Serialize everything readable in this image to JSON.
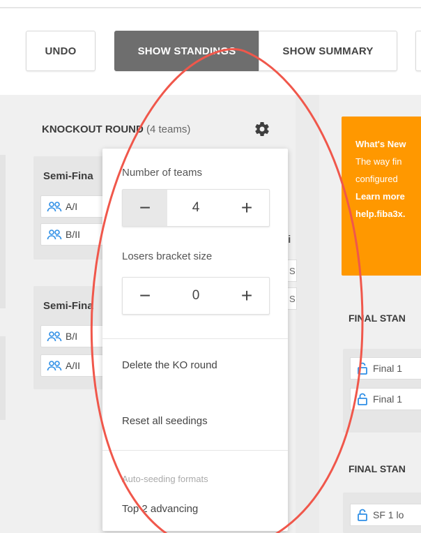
{
  "toolbar": {
    "undo_label": "UNDO",
    "show_standings_label": "SHOW STANDINGS",
    "show_summary_label": "SHOW SUMMARY"
  },
  "knockout": {
    "title": "KNOCKOUT ROUND",
    "team_count": "(4 teams)",
    "semis": [
      {
        "title": "Semi-Fina",
        "teams": [
          "A/I",
          "B/II"
        ]
      },
      {
        "title": "Semi-Fina",
        "teams": [
          "B/I",
          "A/II"
        ]
      }
    ],
    "fragments": {
      "gi": "gi",
      "s1": "S",
      "s2": "S"
    }
  },
  "popover": {
    "teams_label": "Number of teams",
    "teams_value": "4",
    "losers_label": "Losers bracket size",
    "losers_value": "0",
    "minus": "−",
    "plus": "+",
    "delete_label": "Delete the KO round",
    "reset_label": "Reset all seedings",
    "auto_seeding_label": "Auto-seeding formats",
    "top2_label": "Top 2 advancing"
  },
  "whats_new": {
    "title": "What's New",
    "line1": "The way fin",
    "line2": "configured",
    "link1": "Learn more",
    "link2": "help.fiba3x."
  },
  "final_standings": [
    {
      "title": "FINAL STAN",
      "items": [
        "Final 1",
        "Final 1"
      ]
    },
    {
      "title": "FINAL STAN",
      "items": [
        "SF 1 lo"
      ]
    }
  ],
  "colors": {
    "accent_orange": "#ff9800",
    "active_button": "#6e6e6e",
    "team_icon_blue": "#2f8fe6",
    "annotation_red": "#f0574b"
  }
}
